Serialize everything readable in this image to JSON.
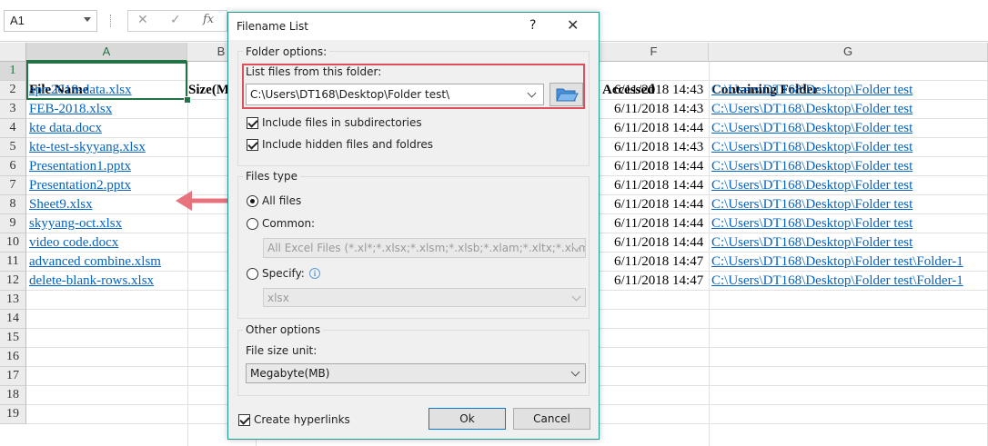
{
  "formula_bar": {
    "name_box": "A1",
    "cancel_icon": "✕",
    "enter_icon": "✓",
    "fx_label": "fx"
  },
  "columns": [
    "A",
    "B",
    "F",
    "G"
  ],
  "rows": [
    "1",
    "2",
    "3",
    "4",
    "5",
    "6",
    "7",
    "8",
    "9",
    "10",
    "11",
    "12",
    "13",
    "14",
    "15",
    "16",
    "17",
    "18",
    "19"
  ],
  "headers": {
    "file_name": "File Name",
    "size": "Size(M",
    "accessed": "Accessed",
    "containing_folder": "Containing Folder"
  },
  "files": [
    {
      "name": "apr-2018-data.xlsx",
      "accessed": "6/11/2018 14:43",
      "folder": "C:\\Users\\DT168\\Desktop\\Folder test"
    },
    {
      "name": "FEB-2018.xlsx",
      "accessed": "6/11/2018 14:43",
      "folder": "C:\\Users\\DT168\\Desktop\\Folder test"
    },
    {
      "name": "kte data.docx",
      "accessed": "6/11/2018 14:44",
      "folder": "C:\\Users\\DT168\\Desktop\\Folder test"
    },
    {
      "name": "kte-test-skyyang.xlsx",
      "accessed": "6/11/2018 14:43",
      "folder": "C:\\Users\\DT168\\Desktop\\Folder test"
    },
    {
      "name": "Presentation1.pptx",
      "accessed": "6/11/2018 14:44",
      "folder": "C:\\Users\\DT168\\Desktop\\Folder test"
    },
    {
      "name": "Presentation2.pptx",
      "accessed": "6/11/2018 14:44",
      "folder": "C:\\Users\\DT168\\Desktop\\Folder test"
    },
    {
      "name": "Sheet9.xlsx",
      "accessed": "6/11/2018 14:44",
      "folder": "C:\\Users\\DT168\\Desktop\\Folder test"
    },
    {
      "name": "skyyang-oct.xlsx",
      "accessed": "6/11/2018 14:44",
      "folder": "C:\\Users\\DT168\\Desktop\\Folder test"
    },
    {
      "name": "video code.docx",
      "accessed": "6/11/2018 14:44",
      "folder": "C:\\Users\\DT168\\Desktop\\Folder test"
    },
    {
      "name": "advanced combine.xlsm",
      "accessed": "6/11/2018 14:47",
      "folder": "C:\\Users\\DT168\\Desktop\\Folder test\\Folder-1"
    },
    {
      "name": "delete-blank-rows.xlsx",
      "accessed": "6/11/2018 14:47",
      "folder": "C:\\Users\\DT168\\Desktop\\Folder test\\Folder-1"
    }
  ],
  "colors": {
    "excel_green": "#217346",
    "link_blue": "#0563c1",
    "arrow_pink": "#e8737f",
    "highlight_red": "#e0505a",
    "dialog_border": "#1e9b8d"
  },
  "dialog": {
    "title": "Filename List",
    "help": "?",
    "close": "✕",
    "folder_options": {
      "legend": "Folder options:",
      "list_label": "List files from this folder:",
      "path": "C:\\Users\\DT168\\Desktop\\Folder test\\",
      "include_subdirs": {
        "label": "Include files in subdirectories",
        "checked": true
      },
      "include_hidden": {
        "label": "Include hidden files and foldres",
        "checked": true
      }
    },
    "files_type": {
      "legend": "Files type",
      "all_files": {
        "label": "All files",
        "selected": true
      },
      "common": {
        "label": "Common:",
        "selected": false,
        "value": "All Excel Files (*.xl*;*.xlsx;*.xlsm;*.xlsb;*.xlam;*.xltx;*.xltm;*"
      },
      "specify": {
        "label": "Specify:",
        "selected": false,
        "value": "xlsx"
      }
    },
    "other_options": {
      "legend": "Other options",
      "size_unit_label": "File size unit:",
      "size_unit_value": "Megabyte(MB)"
    },
    "create_hyperlinks": {
      "label": "Create hyperlinks",
      "checked": true
    },
    "ok": "Ok",
    "cancel": "Cancel"
  }
}
